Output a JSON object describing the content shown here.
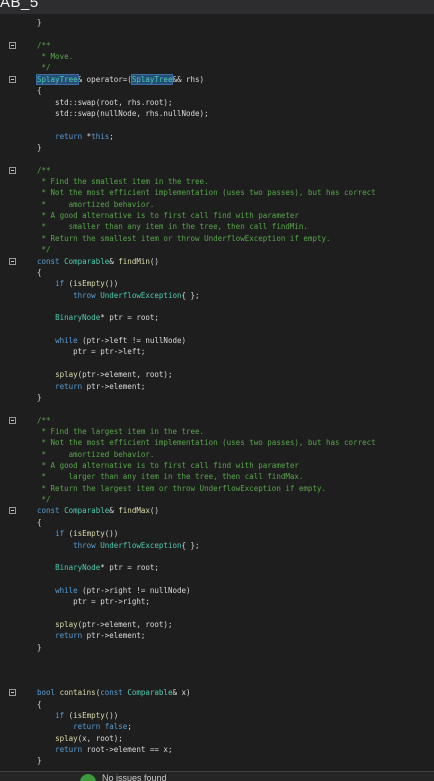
{
  "window": {
    "title": "AB_5"
  },
  "code": {
    "lines": [
      [
        [
          "}",
          "id"
        ]
      ],
      [],
      [
        [
          "/**",
          "cm"
        ]
      ],
      [
        [
          " * Move.",
          "cm"
        ]
      ],
      [
        [
          " */",
          "cm"
        ]
      ],
      [
        [
          "SplayTree",
          "type-hl"
        ],
        [
          "& operator=(",
          "id"
        ],
        [
          "SplayTree",
          "type-hl"
        ],
        [
          "&& rhs)",
          "id"
        ]
      ],
      [
        [
          "{",
          "id"
        ]
      ],
      [
        [
          "    std::swap(root, rhs.root);",
          "id"
        ]
      ],
      [
        [
          "    std::swap(nullNode, rhs.nullNode);",
          "id"
        ]
      ],
      [],
      [
        [
          "    ",
          "id"
        ],
        [
          "return",
          "kw"
        ],
        [
          " *",
          "id"
        ],
        [
          "this",
          "kw"
        ],
        [
          ";",
          "id"
        ]
      ],
      [
        [
          "}",
          "id"
        ]
      ],
      [],
      [
        [
          "/**",
          "cm"
        ]
      ],
      [
        [
          " * Find the smallest item in the tree.",
          "cm"
        ]
      ],
      [
        [
          " * Not the most efficient implementation (uses two passes), but has correct",
          "cm"
        ]
      ],
      [
        [
          " *     amortized behavior.",
          "cm"
        ]
      ],
      [
        [
          " * A good alternative is to first call find with parameter",
          "cm"
        ]
      ],
      [
        [
          " *     smaller than any item in the tree, then call findMin.",
          "cm"
        ]
      ],
      [
        [
          " * Return the smallest item or throw UnderflowException if empty.",
          "cm"
        ]
      ],
      [
        [
          " */",
          "cm"
        ]
      ],
      [
        [
          "const",
          "kw"
        ],
        [
          " ",
          "id"
        ],
        [
          "Comparable",
          "type"
        ],
        [
          "& ",
          "id"
        ],
        [
          "findMin",
          "fn"
        ],
        [
          "()",
          "id"
        ]
      ],
      [
        [
          "{",
          "id"
        ]
      ],
      [
        [
          "    ",
          "id"
        ],
        [
          "if",
          "kw"
        ],
        [
          " (",
          "id"
        ],
        [
          "isEmpty",
          "fn"
        ],
        [
          "())",
          "id"
        ]
      ],
      [
        [
          "        ",
          "id"
        ],
        [
          "throw",
          "kw"
        ],
        [
          " ",
          "id"
        ],
        [
          "UnderflowException",
          "type"
        ],
        [
          "{ };",
          "id"
        ]
      ],
      [],
      [
        [
          "    ",
          "id"
        ],
        [
          "BinaryNode",
          "type"
        ],
        [
          "* ptr = root;",
          "id"
        ]
      ],
      [],
      [
        [
          "    ",
          "id"
        ],
        [
          "while",
          "kw"
        ],
        [
          " (ptr->left != nullNode)",
          "id"
        ]
      ],
      [
        [
          "        ptr = ptr->left;",
          "id"
        ]
      ],
      [],
      [
        [
          "    ",
          "id"
        ],
        [
          "splay",
          "fn"
        ],
        [
          "(ptr->element, root);",
          "id"
        ]
      ],
      [
        [
          "    ",
          "id"
        ],
        [
          "return",
          "kw"
        ],
        [
          " ptr->element;",
          "id"
        ]
      ],
      [
        [
          "}",
          "id"
        ]
      ],
      [],
      [
        [
          "/**",
          "cm"
        ]
      ],
      [
        [
          " * Find the largest item in the tree.",
          "cm"
        ]
      ],
      [
        [
          " * Not the most efficient implementation (uses two passes), but has correct",
          "cm"
        ]
      ],
      [
        [
          " *     amortized behavior.",
          "cm"
        ]
      ],
      [
        [
          " * A good alternative is to first call find with parameter",
          "cm"
        ]
      ],
      [
        [
          " *     larger than any item in the tree, then call findMax.",
          "cm"
        ]
      ],
      [
        [
          " * Return the largest item or throw UnderflowException if empty.",
          "cm"
        ]
      ],
      [
        [
          " */",
          "cm"
        ]
      ],
      [
        [
          "const",
          "kw"
        ],
        [
          " ",
          "id"
        ],
        [
          "Comparable",
          "type"
        ],
        [
          "& ",
          "id"
        ],
        [
          "findMax",
          "fn"
        ],
        [
          "()",
          "id"
        ]
      ],
      [
        [
          "{",
          "id"
        ]
      ],
      [
        [
          "    ",
          "id"
        ],
        [
          "if",
          "kw"
        ],
        [
          " (",
          "id"
        ],
        [
          "isEmpty",
          "fn"
        ],
        [
          "())",
          "id"
        ]
      ],
      [
        [
          "        ",
          "id"
        ],
        [
          "throw",
          "kw"
        ],
        [
          " ",
          "id"
        ],
        [
          "UnderflowException",
          "type"
        ],
        [
          "{ };",
          "id"
        ]
      ],
      [],
      [
        [
          "    ",
          "id"
        ],
        [
          "BinaryNode",
          "type"
        ],
        [
          "* ptr = root;",
          "id"
        ]
      ],
      [],
      [
        [
          "    ",
          "id"
        ],
        [
          "while",
          "kw"
        ],
        [
          " (ptr->right != nullNode)",
          "id"
        ]
      ],
      [
        [
          "        ptr = ptr->right;",
          "id"
        ]
      ],
      [],
      [
        [
          "    ",
          "id"
        ],
        [
          "splay",
          "fn"
        ],
        [
          "(ptr->element, root);",
          "id"
        ]
      ],
      [
        [
          "    ",
          "id"
        ],
        [
          "return",
          "kw"
        ],
        [
          " ptr->element;",
          "id"
        ]
      ],
      [
        [
          "}",
          "id"
        ]
      ],
      [],
      [],
      [],
      [
        [
          "bool",
          "kw"
        ],
        [
          " ",
          "id"
        ],
        [
          "contains",
          "fn"
        ],
        [
          "(",
          "id"
        ],
        [
          "const",
          "kw"
        ],
        [
          " ",
          "id"
        ],
        [
          "Comparable",
          "type"
        ],
        [
          "& x)",
          "id"
        ]
      ],
      [
        [
          "{",
          "id"
        ]
      ],
      [
        [
          "    ",
          "id"
        ],
        [
          "if",
          "kw"
        ],
        [
          " (",
          "id"
        ],
        [
          "isEmpty",
          "fn"
        ],
        [
          "())",
          "id"
        ]
      ],
      [
        [
          "        ",
          "id"
        ],
        [
          "return",
          "kw"
        ],
        [
          " ",
          "id"
        ],
        [
          "false",
          "kw"
        ],
        [
          ";",
          "id"
        ]
      ],
      [
        [
          "    ",
          "id"
        ],
        [
          "splay",
          "fn"
        ],
        [
          "(x, root);",
          "id"
        ]
      ],
      [
        [
          "    ",
          "id"
        ],
        [
          "return",
          "kw"
        ],
        [
          " root->element == x;",
          "id"
        ]
      ],
      [
        [
          "}",
          "id"
        ]
      ]
    ]
  },
  "status": {
    "icon": "status-ok-icon",
    "text": "No issues found"
  }
}
